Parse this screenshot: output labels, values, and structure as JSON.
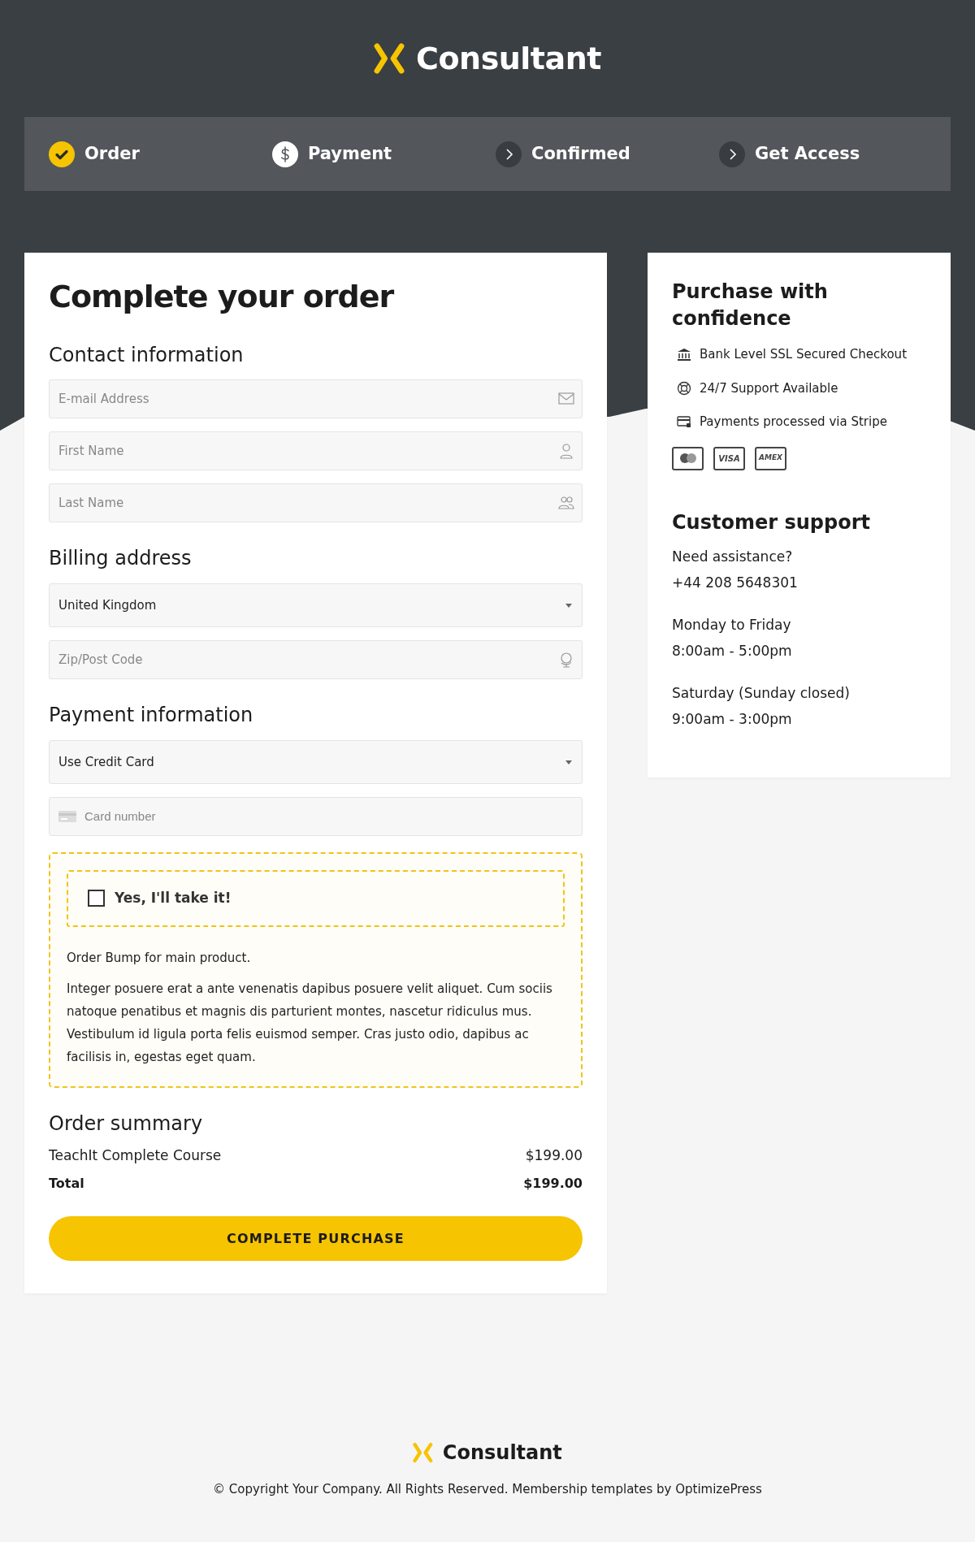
{
  "logo": {
    "text": "Consultant"
  },
  "steps": [
    {
      "label": "Order",
      "completed": true,
      "selected": false
    },
    {
      "label": "Payment",
      "completed": false,
      "selected": true
    },
    {
      "label": "Confirmed",
      "completed": false,
      "selected": false
    },
    {
      "label": "Get Access",
      "completed": false,
      "selected": false
    }
  ],
  "order_form": {
    "title": "Complete your order",
    "sections": [
      {
        "heading": "Contact information",
        "fields": [
          {
            "kind": "email",
            "placeholder": "E-mail Address"
          },
          {
            "kind": "person",
            "placeholder": "First Name"
          },
          {
            "kind": "people",
            "placeholder": "Last Name"
          }
        ]
      },
      {
        "heading": "Billing address",
        "fields": [
          {
            "kind": "select",
            "value": "United Kingdom"
          },
          {
            "kind": "postcode",
            "placeholder": "Zip/Post Code"
          }
        ]
      },
      {
        "heading": "Payment information",
        "fields": [
          {
            "kind": "select",
            "value": "Use Credit Card"
          },
          {
            "kind": "card",
            "placeholder": "Card number"
          }
        ]
      }
    ]
  },
  "order_bump": {
    "checkbox_label": "Yes, I'll take it!",
    "checked": false,
    "intro": "Order Bump for main product.",
    "body": "Integer posuere erat a ante venenatis dapibus posuere velit aliquet. Cum sociis natoque penatibus et magnis dis parturient montes, nascetur ridiculus mus. Vestibulum id ligula porta felis euismod semper. Cras justo odio, dapibus ac facilisis in, egestas eget quam."
  },
  "order_summary": {
    "heading": "Order summary",
    "items": [
      {
        "name": "TeachIt Complete Course",
        "price": "$199.00"
      }
    ],
    "total_label": "Total",
    "total": "$199.00"
  },
  "purchase_button": "COMPLETE PURCHASE",
  "confidence": {
    "title": "Purchase with confidence",
    "features": [
      {
        "kind": "bank",
        "text": "Bank Level SSL Secured Checkout"
      },
      {
        "kind": "support",
        "text": "24/7 Support Available"
      },
      {
        "kind": "card",
        "text": "Payments processed via Stripe"
      }
    ],
    "badges": [
      {
        "kind": "mastercard"
      },
      {
        "kind": "visa",
        "text": "VISA"
      },
      {
        "kind": "amex",
        "text": "AMEX"
      }
    ]
  },
  "support": {
    "heading": "Customer support",
    "blocks": [
      {
        "label": "Need assistance?",
        "value": "+44 208 5648301"
      },
      {
        "label": "Monday to Friday",
        "value": "8:00am - 5:00pm"
      },
      {
        "label": "Saturday (Sunday closed)",
        "value": "9:00am - 3:00pm"
      }
    ]
  },
  "footer": {
    "logo_text": "Consultant",
    "copyright": "© Copyright Your Company. All Rights Reserved. Membership templates by OptimizePress"
  }
}
